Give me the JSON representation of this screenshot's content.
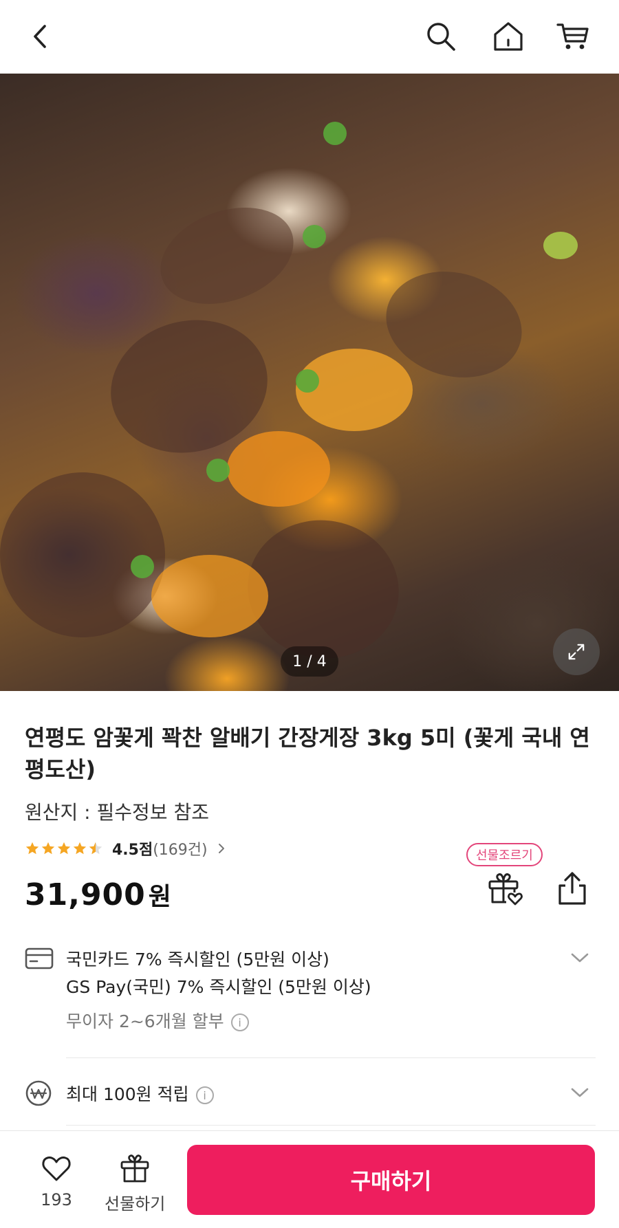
{
  "header": {
    "back_icon": "chevron-left-icon",
    "search_icon": "search-icon",
    "home_icon": "home-icon",
    "cart_icon": "cart-icon"
  },
  "gallery": {
    "image_alt": "간장게장",
    "pager": "1 / 4"
  },
  "product": {
    "title": "연평도 암꽃게 꽉찬 알배기 간장게장 3kg 5미 (꽃게 국내 연평도산)",
    "origin": "원산지 : 필수정보 참조",
    "rating": 4.5,
    "rating_score": "4.5점",
    "rating_count": "(169건)",
    "gift_badge": "선물조르기",
    "price": "31,900",
    "price_unit": "원"
  },
  "benefits": {
    "card_discount_1": "국민카드 7% 즉시할인 (5만원 이상)",
    "card_discount_2": "GS Pay(국민) 7% 즉시할인 (5만원 이상)",
    "installment": "무이자 2~6개월 할부",
    "points": "최대 100원 적립"
  },
  "bottom_bar": {
    "like_count": "193",
    "gift_label": "선물하기",
    "buy_label": "구매하기"
  },
  "colors": {
    "accent": "#ee1e5e",
    "gift_badge": "#e3457a",
    "star": "#f5a623"
  }
}
